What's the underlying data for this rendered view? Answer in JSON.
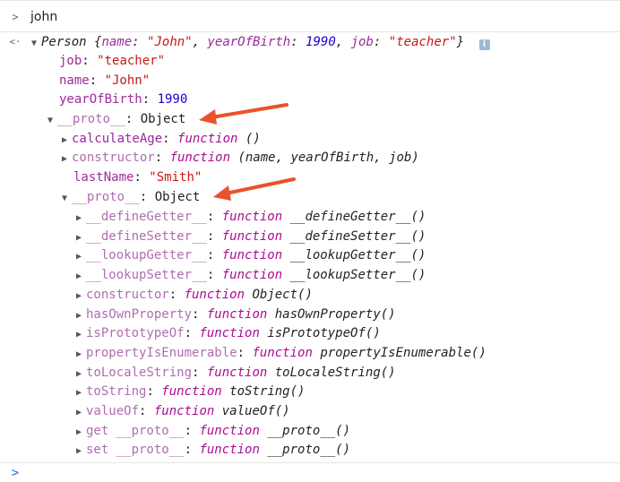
{
  "console": {
    "input_prompt_glyph": ">",
    "input_text": "john",
    "result_back_glyph": "<·",
    "result_summary": {
      "class": "Person",
      "open": "{",
      "k1": "name",
      "v1": "\"John\"",
      "k2": "yearOfBirth",
      "v2": "1990",
      "k3": "job",
      "v3": "\"teacher\"",
      "close": "}"
    },
    "own_props": [
      {
        "key": "job",
        "value": "\"teacher\""
      },
      {
        "key": "name",
        "value": "\"John\""
      },
      {
        "key": "yearOfBirth",
        "value": "1990"
      }
    ],
    "proto1": {
      "key": "__proto__",
      "value": "Object"
    },
    "proto1_props": [
      {
        "key": "calculateAge",
        "kw": "function",
        "rest": "()"
      },
      {
        "key": "constructor",
        "kw": "function",
        "rest": "(name, yearOfBirth, job)"
      }
    ],
    "lastName": {
      "key": "lastName",
      "value": "\"Smith\""
    },
    "proto2": {
      "key": "__proto__",
      "value": "Object"
    },
    "proto2_props": [
      {
        "key": "__defineGetter__",
        "kw": "function",
        "rest": "__defineGetter__()"
      },
      {
        "key": "__defineSetter__",
        "kw": "function",
        "rest": "__defineSetter__()"
      },
      {
        "key": "__lookupGetter__",
        "kw": "function",
        "rest": "__lookupGetter__()"
      },
      {
        "key": "__lookupSetter__",
        "kw": "function",
        "rest": "__lookupSetter__()"
      },
      {
        "key": "constructor",
        "kw": "function",
        "rest": "Object()"
      },
      {
        "key": "hasOwnProperty",
        "kw": "function",
        "rest": "hasOwnProperty()"
      },
      {
        "key": "isPrototypeOf",
        "kw": "function",
        "rest": "isPrototypeOf()"
      },
      {
        "key": "propertyIsEnumerable",
        "kw": "function",
        "rest": "propertyIsEnumerable()"
      },
      {
        "key": "toLocaleString",
        "kw": "function",
        "rest": "toLocaleString()"
      },
      {
        "key": "toString",
        "kw": "function",
        "rest": "toString()"
      },
      {
        "key": "valueOf",
        "kw": "function",
        "rest": "valueOf()"
      },
      {
        "key": "get __proto__",
        "kw": "function",
        "rest": "__proto__()"
      },
      {
        "key": "set __proto__",
        "kw": "function",
        "rest": "__proto__()"
      }
    ],
    "bottom_prompt_glyph": ">"
  },
  "colors": {
    "arrow": "#e8532b",
    "prompt_blue": "#1a73e8"
  }
}
